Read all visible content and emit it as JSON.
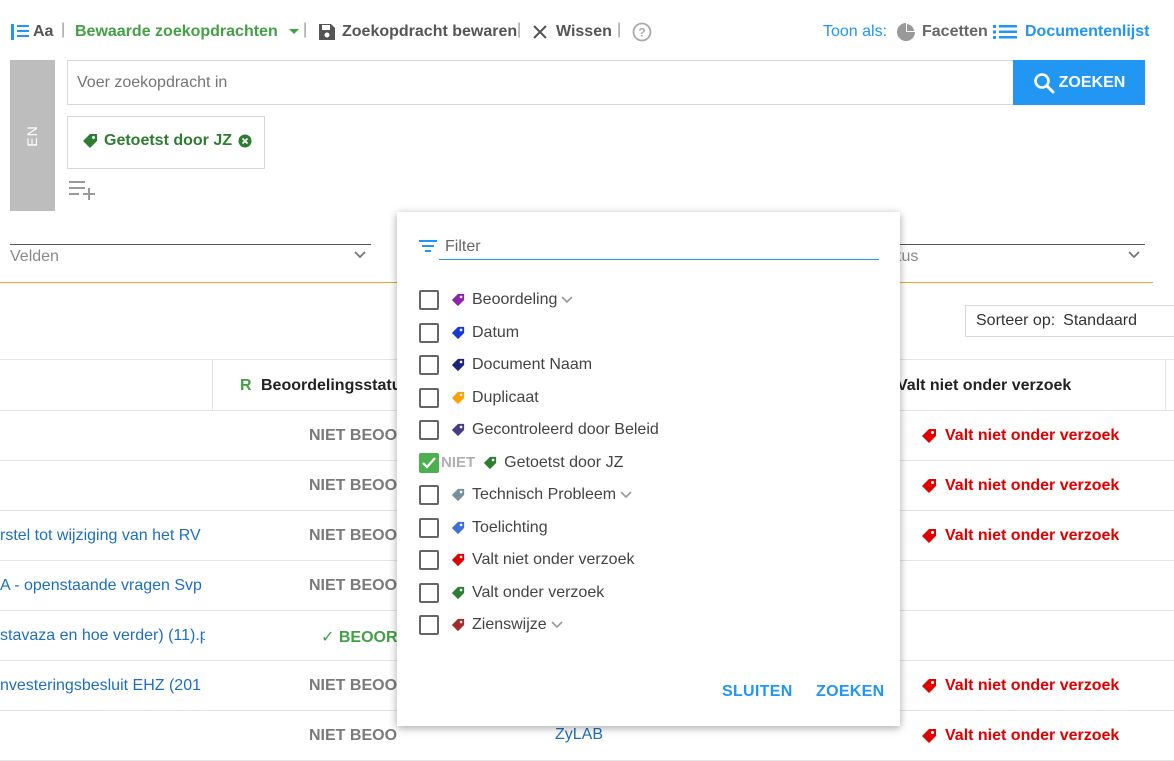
{
  "toolbar": {
    "aa_label": "Aa",
    "saved_searches_label": "Bewaarde zoekopdrachten",
    "save_search_label": "Zoekopdracht bewaren",
    "clear_label": "Wissen",
    "show_as_label": "Toon als:",
    "facets_label": "Facetten",
    "document_list_label": "Documentenlijst"
  },
  "search": {
    "operator_label": "EN",
    "placeholder": "Voer zoekopdracht in",
    "value": "",
    "button_label": "ZOEKEN",
    "chip_label": "Getoetst door JZ"
  },
  "facets": {
    "fields_label": "Velden",
    "status_label": "tus"
  },
  "sort": {
    "label": "Sorteer op:",
    "value": "Standaard"
  },
  "table": {
    "headers": {
      "review_prefix": "R",
      "review_status": "Beoordelingsstatus",
      "not_in_request": "Valt niet onder verzoek"
    },
    "rows": [
      {
        "name": "",
        "status": "NIET BEOORDEELD",
        "tag": "Valt niet onder verzoek"
      },
      {
        "name": "",
        "status": "NIET BEOORDEELD",
        "tag": "Valt niet onder verzoek"
      },
      {
        "name": "rstel tot wijziging van het RV",
        "status": "NIET BEOORDEELD",
        "tag": "Valt niet onder verzoek"
      },
      {
        "name": "A - openstaande vragen Svp",
        "status": "NIET BEOORDEELD",
        "tag": ""
      },
      {
        "name": "stavaza en hoe verder) (11).p",
        "status": "BEOORDEELD",
        "ok": true,
        "tag": ""
      },
      {
        "name": "nvesteringsbesluit EHZ (201",
        "status": "NIET BEOORDEELD",
        "tag": "Valt niet onder verzoek"
      },
      {
        "name": "",
        "status": "NIET BEOORDEELD",
        "extra": "ZyLAB",
        "tag": "Valt niet onder verzoek"
      }
    ]
  },
  "popup": {
    "filter_placeholder": "Filter",
    "filter_value": "",
    "not_label": "NIET",
    "options": [
      {
        "label": "Beoordeling",
        "color": "#8e24aa",
        "checked": false,
        "expandable": true
      },
      {
        "label": "Datum",
        "color": "#1a3ad8",
        "checked": false,
        "expandable": false
      },
      {
        "label": "Document Naam",
        "color": "#1a237e",
        "checked": false,
        "expandable": false
      },
      {
        "label": "Duplicaat",
        "color": "#ffa000",
        "checked": false,
        "expandable": false
      },
      {
        "label": "Gecontroleerd door Beleid",
        "color": "#4a3a8a",
        "checked": false,
        "expandable": false
      },
      {
        "label": "Getoetst door JZ",
        "color": "#2e7d32",
        "checked": true,
        "expandable": false
      },
      {
        "label": "Technisch Probleem",
        "color": "#78909c",
        "checked": false,
        "expandable": true
      },
      {
        "label": "Toelichting",
        "color": "#3f6fd8",
        "checked": false,
        "expandable": false
      },
      {
        "label": "Valt niet onder verzoek",
        "color": "#e00000",
        "checked": false,
        "expandable": false
      },
      {
        "label": "Valt onder verzoek",
        "color": "#2e7d32",
        "checked": false,
        "expandable": false
      },
      {
        "label": "Zienswijze",
        "color": "#a52a2a",
        "checked": false,
        "expandable": true
      }
    ],
    "close_label": "SLUITEN",
    "search_label": "ZOEKEN"
  },
  "colors": {
    "accent": "#2196f3",
    "green": "#2e7d32",
    "red": "#e00000",
    "orange_line": "#f0a030"
  }
}
